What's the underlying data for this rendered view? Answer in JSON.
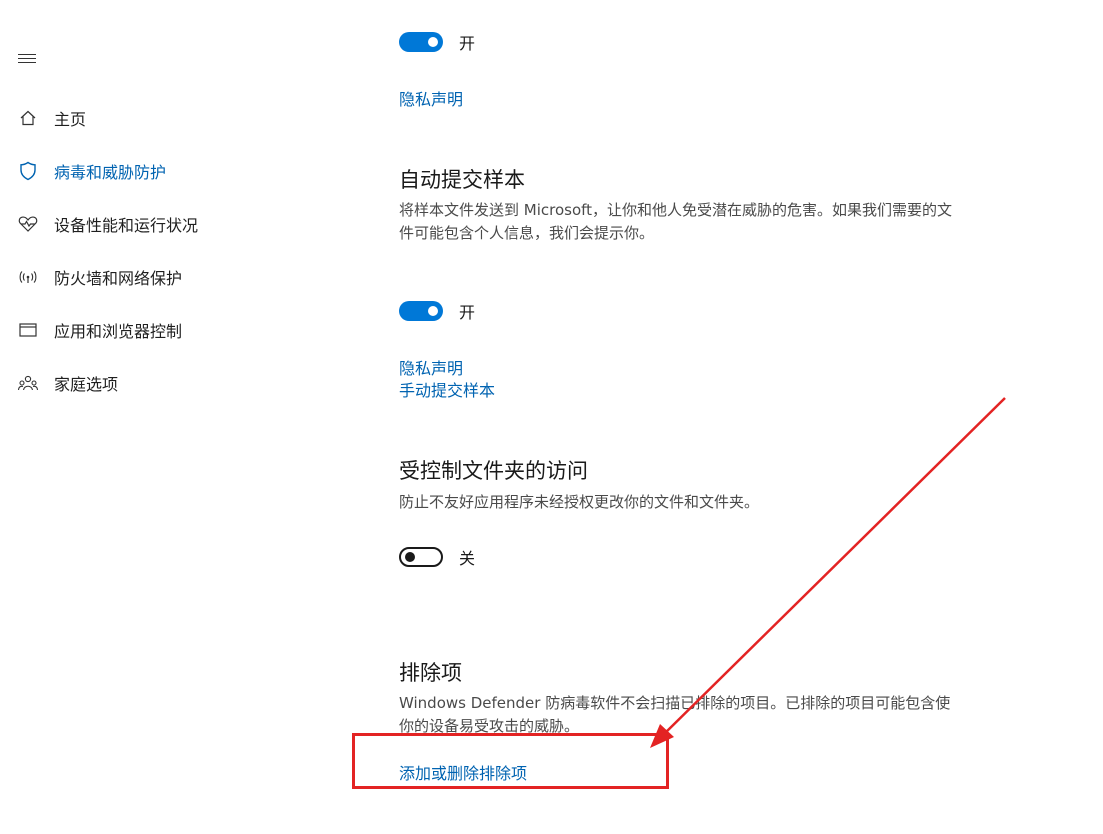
{
  "sidebar": {
    "menu_icon": "hamburger-menu-icon",
    "items": [
      {
        "label": "主页",
        "icon": "home-icon",
        "active": false
      },
      {
        "label": "病毒和威胁防护",
        "icon": "shield-icon",
        "active": true
      },
      {
        "label": "设备性能和运行状况",
        "icon": "heart-pulse-icon",
        "active": false
      },
      {
        "label": "防火墙和网络保护",
        "icon": "wifi-antenna-icon",
        "active": false
      },
      {
        "label": "应用和浏览器控制",
        "icon": "browser-window-icon",
        "active": false
      },
      {
        "label": "家庭选项",
        "icon": "family-icon",
        "active": false
      }
    ]
  },
  "main": {
    "top_toggle": {
      "label": "开",
      "state": "on"
    },
    "top_privacy_link": "隐私声明",
    "auto_sample": {
      "title": "自动提交样本",
      "description": "将样本文件发送到 Microsoft，让你和他人免受潜在威胁的危害。如果我们需要的文件可能包含个人信息，我们会提示你。",
      "toggle": {
        "label": "开",
        "state": "on"
      },
      "privacy_link": "隐私声明",
      "manual_link": "手动提交样本"
    },
    "controlled_folder": {
      "title": "受控制文件夹的访问",
      "description": "防止不友好应用程序未经授权更改你的文件和文件夹。",
      "toggle": {
        "label": "关",
        "state": "off"
      }
    },
    "exclusions": {
      "title": "排除项",
      "description": "Windows Defender 防病毒软件不会扫描已排除的项目。已排除的项目可能包含使你的设备易受攻击的威胁。",
      "link": "添加或删除排除项"
    }
  },
  "colors": {
    "accent": "#0078d7",
    "link": "#0063b1",
    "annotation_red": "#e32323"
  }
}
